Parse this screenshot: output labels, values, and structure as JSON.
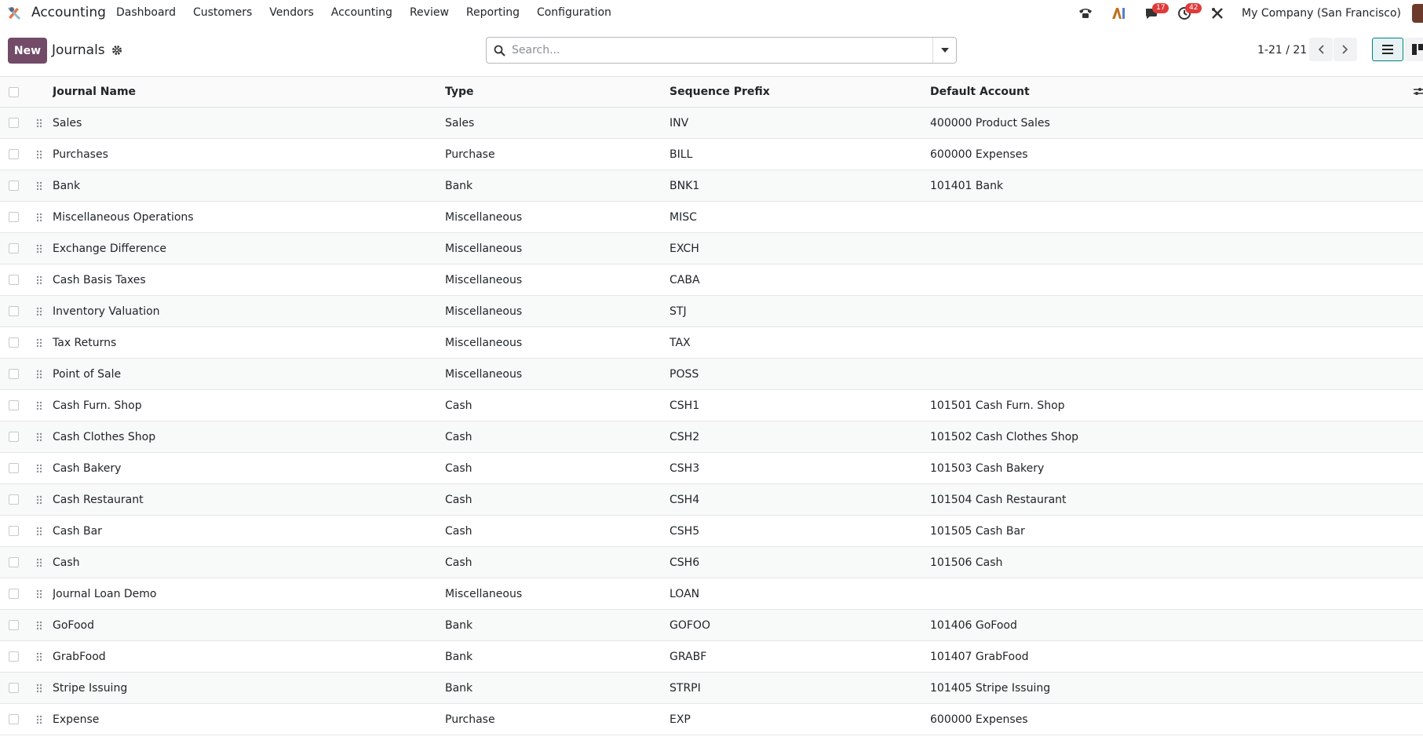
{
  "navbar": {
    "app_name": "Accounting",
    "menu": [
      "Dashboard",
      "Customers",
      "Vendors",
      "Accounting",
      "Review",
      "Reporting",
      "Configuration"
    ],
    "messages_count": "17",
    "activities_count": "42",
    "company": "My Company (San Francisco)",
    "icons": [
      "phone-icon",
      "ai-icon",
      "chat-icon",
      "clock-icon",
      "tools-icon"
    ]
  },
  "control": {
    "new_label": "New",
    "title": "Journals",
    "search_placeholder": "Search...",
    "pager": "1-21 / 21"
  },
  "table": {
    "columns": [
      "Journal Name",
      "Type",
      "Sequence Prefix",
      "Default Account"
    ],
    "rows": [
      {
        "name": "Sales",
        "type": "Sales",
        "prefix": "INV",
        "account": "400000 Product Sales"
      },
      {
        "name": "Purchases",
        "type": "Purchase",
        "prefix": "BILL",
        "account": "600000 Expenses"
      },
      {
        "name": "Bank",
        "type": "Bank",
        "prefix": "BNK1",
        "account": "101401 Bank"
      },
      {
        "name": "Miscellaneous Operations",
        "type": "Miscellaneous",
        "prefix": "MISC",
        "account": ""
      },
      {
        "name": "Exchange Difference",
        "type": "Miscellaneous",
        "prefix": "EXCH",
        "account": ""
      },
      {
        "name": "Cash Basis Taxes",
        "type": "Miscellaneous",
        "prefix": "CABA",
        "account": ""
      },
      {
        "name": "Inventory Valuation",
        "type": "Miscellaneous",
        "prefix": "STJ",
        "account": ""
      },
      {
        "name": "Tax Returns",
        "type": "Miscellaneous",
        "prefix": "TAX",
        "account": ""
      },
      {
        "name": "Point of Sale",
        "type": "Miscellaneous",
        "prefix": "POSS",
        "account": ""
      },
      {
        "name": "Cash Furn. Shop",
        "type": "Cash",
        "prefix": "CSH1",
        "account": "101501 Cash Furn. Shop"
      },
      {
        "name": "Cash Clothes Shop",
        "type": "Cash",
        "prefix": "CSH2",
        "account": "101502 Cash Clothes Shop"
      },
      {
        "name": "Cash Bakery",
        "type": "Cash",
        "prefix": "CSH3",
        "account": "101503 Cash Bakery"
      },
      {
        "name": "Cash Restaurant",
        "type": "Cash",
        "prefix": "CSH4",
        "account": "101504 Cash Restaurant"
      },
      {
        "name": "Cash Bar",
        "type": "Cash",
        "prefix": "CSH5",
        "account": "101505 Cash Bar"
      },
      {
        "name": "Cash",
        "type": "Cash",
        "prefix": "CSH6",
        "account": "101506 Cash"
      },
      {
        "name": "Journal Loan Demo",
        "type": "Miscellaneous",
        "prefix": "LOAN",
        "account": ""
      },
      {
        "name": "GoFood",
        "type": "Bank",
        "prefix": "GOFOO",
        "account": "101406 GoFood"
      },
      {
        "name": "GrabFood",
        "type": "Bank",
        "prefix": "GRABF",
        "account": "101407 GrabFood"
      },
      {
        "name": "Stripe Issuing",
        "type": "Bank",
        "prefix": "STRPI",
        "account": "101405 Stripe Issuing"
      },
      {
        "name": "Expense",
        "type": "Purchase",
        "prefix": "EXP",
        "account": "600000 Expenses"
      }
    ]
  },
  "colors": {
    "brand": "#714b67",
    "accent": "#017e84",
    "badge": "#e03b3b"
  }
}
